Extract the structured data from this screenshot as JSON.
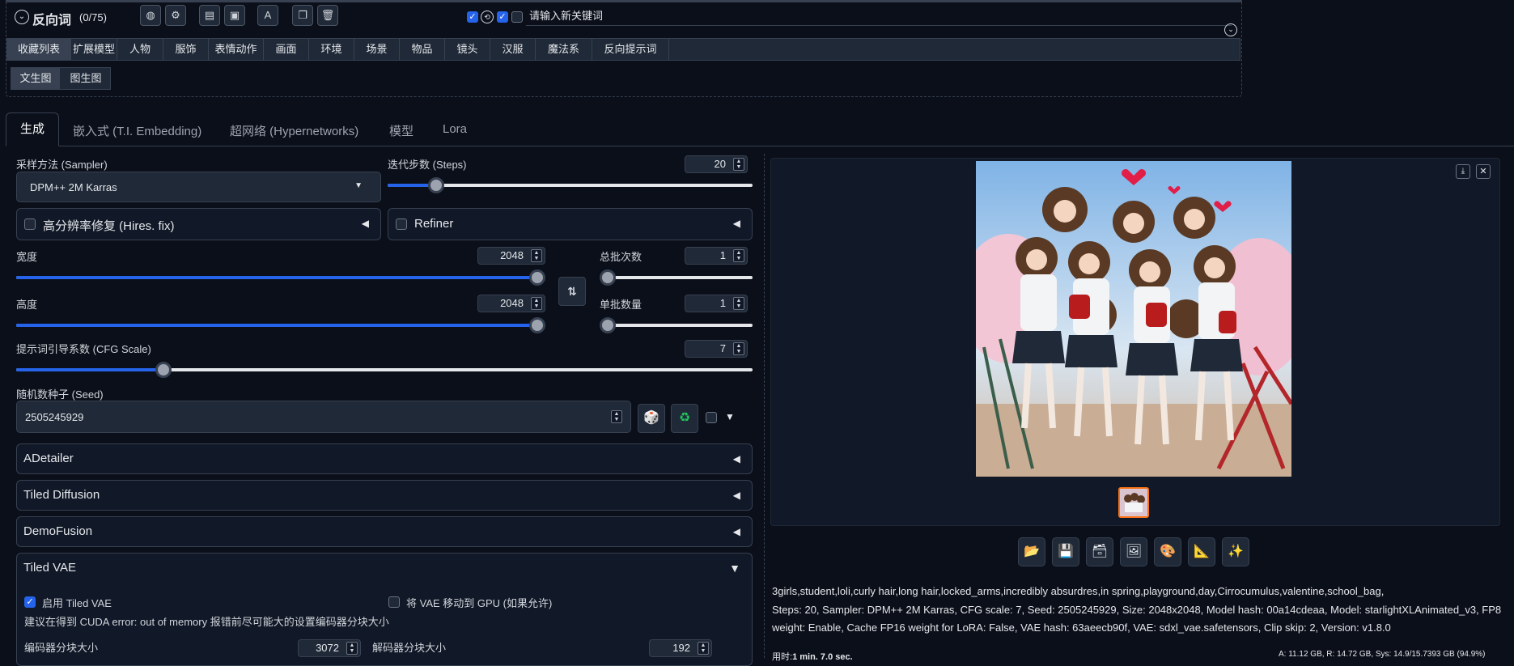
{
  "top": {
    "negative_label": "反向词",
    "negative_count": "(0/75)",
    "keyword_placeholder": "请输入新关键词"
  },
  "category_tabs": [
    "收藏列表",
    "扩展模型",
    "人物",
    "服饰",
    "表情动作",
    "画面",
    "环境",
    "场景",
    "物品",
    "镜头",
    "汉服",
    "魔法系",
    "反向提示词"
  ],
  "sub_tabs": [
    "文生图",
    "图生图"
  ],
  "main_tabs": [
    "生成",
    "嵌入式 (T.I. Embedding)",
    "超网络 (Hypernetworks)",
    "模型",
    "Lora"
  ],
  "sampler": {
    "label": "采样方法 (Sampler)",
    "value": "DPM++ 2M Karras"
  },
  "steps": {
    "label": "迭代步数 (Steps)",
    "value": "20",
    "fraction": 0.133
  },
  "hires": {
    "label": "高分辨率修复 (Hires. fix)"
  },
  "refiner": {
    "label": "Refiner"
  },
  "width": {
    "label": "宽度",
    "value": "2048",
    "fraction": 1.0
  },
  "height": {
    "label": "高度",
    "value": "2048",
    "fraction": 1.0
  },
  "batch_count": {
    "label": "总批次数",
    "value": "1",
    "fraction": 0.0
  },
  "batch_size": {
    "label": "单批数量",
    "value": "1",
    "fraction": 0.0
  },
  "cfg": {
    "label": "提示词引导系数 (CFG Scale)",
    "value": "7",
    "fraction": 0.2
  },
  "seed": {
    "label": "随机数种子 (Seed)",
    "value": "2505245929"
  },
  "accordions": {
    "adetailer": "ADetailer",
    "tiled_diffusion": "Tiled Diffusion",
    "demofusion": "DemoFusion",
    "tiled_vae": "Tiled VAE"
  },
  "tiled_vae": {
    "enable_label": "启用 Tiled VAE",
    "move_gpu_label": "将 VAE 移动到 GPU (如果允许)",
    "hint": "建议在得到 CUDA error: out of memory 报错前尽可能大的设置编码器分块大小",
    "encoder_label": "编码器分块大小",
    "encoder_value": "3072",
    "decoder_label": "解码器分块大小",
    "decoder_value": "192"
  },
  "output": {
    "prompt_line": "3girls,student,loli,curly hair,long hair,locked_arms,incredibly absurdres,in spring,playground,day,Cirrocumulus,valentine,school_bag,",
    "params_line1": "Steps: 20, Sampler: DPM++ 2M Karras, CFG scale: 7, Seed: 2505245929, Size: 2048x2048, Model hash: 00a14cdeaa, Model: starlightXLAnimated_v3, FP8",
    "params_line2": "weight: Enable, Cache FP16 weight for LoRA: False, VAE hash: 63aeecb90f, VAE: sdxl_vae.safetensors, Clip skip: 2, Version: v1.8.0",
    "time_label": "用时:",
    "time_value": "1 min. 7.0 sec.",
    "vram": "A: 11.12 GB, R: 14.72 GB, Sys: 14.9/15.7393 GB (94.9%)"
  },
  "icons": [
    "folder-icon",
    "save-icon",
    "zip-icon",
    "image-icon",
    "palette-icon",
    "ruler-icon",
    "sparkle-icon"
  ]
}
